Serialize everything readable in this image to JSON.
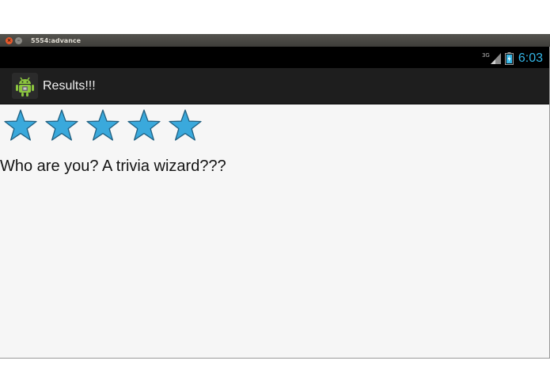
{
  "window": {
    "title": "5554:advance",
    "close_glyph": "×",
    "minimize_glyph": "–"
  },
  "status_bar": {
    "network_label": "3G",
    "time": "6:03",
    "clock_color": "#33b5e5"
  },
  "action_bar": {
    "icon": "android-robot-icon",
    "title": "Results!!!"
  },
  "rating": {
    "value": 5,
    "max": 5,
    "star_color": "#3aa9dc"
  },
  "result": {
    "message": "Who are you? A trivia wizard???"
  }
}
